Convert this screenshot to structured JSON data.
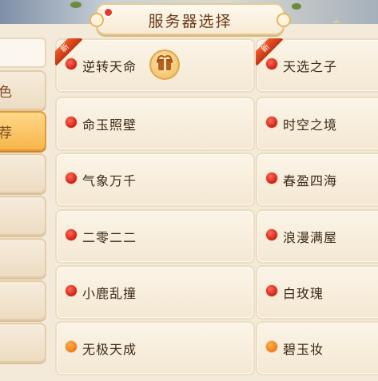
{
  "header": {
    "title": "服务器选择"
  },
  "sidebar": {
    "tabs": [
      {
        "label": "角色",
        "visible_text": "色",
        "active": false
      },
      {
        "label": "推荐",
        "visible_text": "荐",
        "active": true
      },
      {
        "label": "",
        "visible_text": "…",
        "active": false
      },
      {
        "label": "",
        "visible_text": "…",
        "active": false
      },
      {
        "label": "",
        "visible_text": "…",
        "active": false
      },
      {
        "label": "",
        "visible_text": "…",
        "active": false
      },
      {
        "label": "",
        "visible_text": "…",
        "active": false
      }
    ]
  },
  "servers": {
    "new_badge": "新",
    "left": [
      {
        "name": "逆转天命",
        "status": "red",
        "new": true,
        "gift": true
      },
      {
        "name": "命玉照壁",
        "status": "red"
      },
      {
        "name": "气象万千",
        "status": "red"
      },
      {
        "name": "二零二二",
        "status": "red"
      },
      {
        "name": "小鹿乱撞",
        "status": "red"
      },
      {
        "name": "无极天成",
        "status": "orange"
      }
    ],
    "right": [
      {
        "name": "天选之子",
        "status": "red",
        "new": true
      },
      {
        "name": "时空之境",
        "status": "red"
      },
      {
        "name": "春盈四海",
        "status": "red"
      },
      {
        "name": "浪漫满屋",
        "status": "red"
      },
      {
        "name": "白玫瑰",
        "status": "red"
      },
      {
        "name": "碧玉妆",
        "status": "orange"
      }
    ]
  },
  "colors": {
    "status_red": "#d8231a",
    "status_orange": "#f27b1a",
    "active_tab": "#f6b64a",
    "title_text": "#6a3a1a"
  }
}
